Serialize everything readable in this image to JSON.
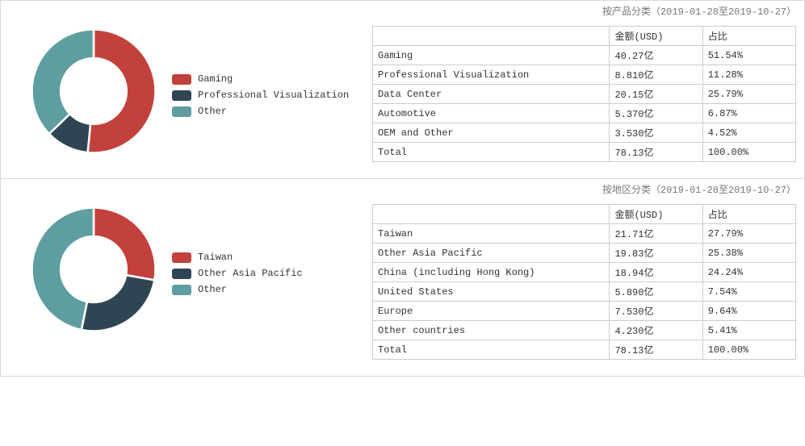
{
  "panels": [
    {
      "title": "按产品分类（2019-01-28至2019-10-27）",
      "legend": [
        "Gaming",
        "Professional Visualization",
        "Other"
      ],
      "table": {
        "headers": [
          "",
          "金额(USD)",
          "占比"
        ],
        "rows": [
          [
            "Gaming",
            "40.27亿",
            "51.54%"
          ],
          [
            "Professional Visualization",
            "8.810亿",
            "11.28%"
          ],
          [
            "Data Center",
            "20.15亿",
            "25.79%"
          ],
          [
            "Automotive",
            "5.370亿",
            "6.87%"
          ],
          [
            "OEM and Other",
            "3.530亿",
            "4.52%"
          ],
          [
            "Total",
            "78.13亿",
            "100.00%"
          ]
        ]
      }
    },
    {
      "title": "按地区分类（2019-01-28至2019-10-27）",
      "legend": [
        "Taiwan",
        "Other Asia Pacific",
        "Other"
      ],
      "table": {
        "headers": [
          "",
          "金额(USD)",
          "占比"
        ],
        "rows": [
          [
            "Taiwan",
            "21.71亿",
            "27.79%"
          ],
          [
            "Other Asia Pacific",
            "19.83亿",
            "25.38%"
          ],
          [
            "China (including Hong Kong)",
            "18.94亿",
            "24.24%"
          ],
          [
            "United States",
            "5.890亿",
            "7.54%"
          ],
          [
            "Europe",
            "7.530亿",
            "9.64%"
          ],
          [
            "Other countries",
            "4.230亿",
            "5.41%"
          ],
          [
            "Total",
            "78.13亿",
            "100.00%"
          ]
        ]
      }
    }
  ],
  "colors": {
    "red": "#c3413c",
    "navy": "#2f4553",
    "teal": "#5e9ea0"
  },
  "chart_data": [
    {
      "type": "pie",
      "title": "按产品分类（2019-01-28至2019-10-27）",
      "series": [
        {
          "name": "Gaming",
          "value": 51.54
        },
        {
          "name": "Professional Visualization",
          "value": 11.28
        },
        {
          "name": "Other",
          "value": 37.18
        }
      ],
      "source_rows": [
        {
          "name": "Gaming",
          "amount_usd_100m": 40.27,
          "pct": 51.54
        },
        {
          "name": "Professional Visualization",
          "amount_usd_100m": 8.81,
          "pct": 11.28
        },
        {
          "name": "Data Center",
          "amount_usd_100m": 20.15,
          "pct": 25.79
        },
        {
          "name": "Automotive",
          "amount_usd_100m": 5.37,
          "pct": 6.87
        },
        {
          "name": "OEM and Other",
          "amount_usd_100m": 3.53,
          "pct": 4.52
        }
      ],
      "total_amount_usd_100m": 78.13
    },
    {
      "type": "pie",
      "title": "按地区分类（2019-01-28至2019-10-27）",
      "series": [
        {
          "name": "Taiwan",
          "value": 27.79
        },
        {
          "name": "Other Asia Pacific",
          "value": 25.38
        },
        {
          "name": "Other",
          "value": 46.83
        }
      ],
      "source_rows": [
        {
          "name": "Taiwan",
          "amount_usd_100m": 21.71,
          "pct": 27.79
        },
        {
          "name": "Other Asia Pacific",
          "amount_usd_100m": 19.83,
          "pct": 25.38
        },
        {
          "name": "China (including Hong Kong)",
          "amount_usd_100m": 18.94,
          "pct": 24.24
        },
        {
          "name": "United States",
          "amount_usd_100m": 5.89,
          "pct": 7.54
        },
        {
          "name": "Europe",
          "amount_usd_100m": 7.53,
          "pct": 9.64
        },
        {
          "name": "Other countries",
          "amount_usd_100m": 4.23,
          "pct": 5.41
        }
      ],
      "total_amount_usd_100m": 78.13
    }
  ]
}
